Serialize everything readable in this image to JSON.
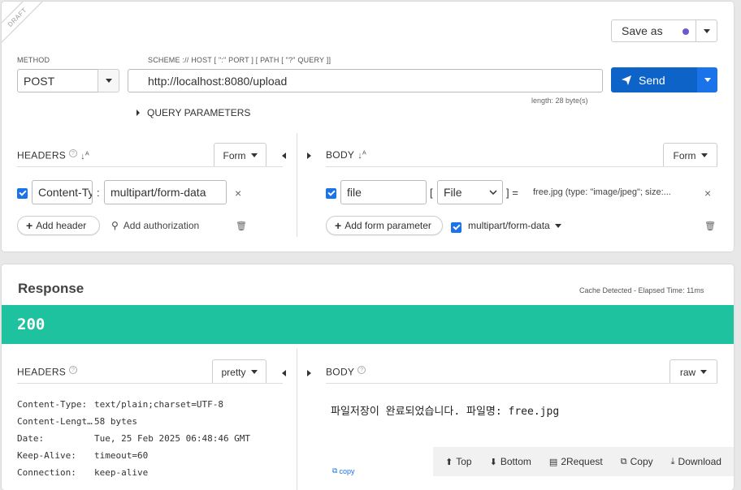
{
  "request": {
    "draft_label": "DRAFT",
    "method_label": "METHOD",
    "method_value": "POST",
    "url_label": "SCHEME :// HOST [ \":\" PORT ] [ PATH [ \"?\" QUERY ]]",
    "url_value": "http://localhost:8080/upload",
    "url_length": "length: 28 byte(s)",
    "save_as_label": "Save as",
    "send_label": "Send",
    "query_params_label": "QUERY PARAMETERS",
    "headers": {
      "title": "HEADERS",
      "format_label": "Form",
      "items": [
        {
          "key": "Content-Type",
          "separator": ":",
          "value": "multipart/form-data"
        }
      ],
      "add_header_label": "Add header",
      "add_auth_label": "Add authorization"
    },
    "body": {
      "title": "BODY",
      "format_label": "Form",
      "items": [
        {
          "name": "file",
          "bracket_open": "[",
          "type": "File",
          "bracket_close": "] =",
          "value": "free.jpg (type: \"image/jpeg\"; size:..."
        }
      ],
      "add_param_label": "Add form parameter",
      "encoding_label": "multipart/form-data"
    }
  },
  "response": {
    "title": "Response",
    "cache_info": "Cache Detected - Elapsed Time: 11ms",
    "status_code": "200",
    "status_color": "#1fc29f",
    "headers": {
      "title": "HEADERS",
      "format_label": "pretty",
      "rows": [
        {
          "key": "Content-Type:",
          "value": "text/plain;charset=UTF-8"
        },
        {
          "key": "Content-Length:",
          "value": "58 bytes"
        },
        {
          "key": "Date:",
          "value": "Tue, 25 Feb 2025 06:48:46 GMT"
        },
        {
          "key": "Keep-Alive:",
          "value": "timeout=60"
        },
        {
          "key": "Connection:",
          "value": "keep-alive"
        }
      ],
      "copy_label": "copy"
    },
    "body": {
      "title": "BODY",
      "format_label": "raw",
      "content": "파일저장이 완료되었습니다. 파일명: free.jpg"
    },
    "toolbar": {
      "top": "Top",
      "bottom": "Bottom",
      "request": "2Request",
      "copy": "Copy",
      "download": "Download"
    }
  },
  "colors": {
    "send_button": "#0e63c8",
    "accent_blue": "#1a73e8",
    "save_dot": "#6a5acd"
  }
}
